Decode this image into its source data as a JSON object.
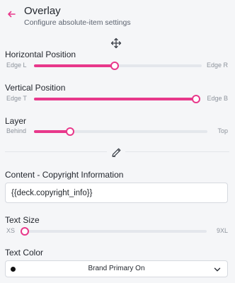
{
  "header": {
    "title": "Overlay",
    "subtitle": "Configure absolute-item settings",
    "back_icon": "arrow-left-icon"
  },
  "accent_color": "#e8388b",
  "sliders": [
    {
      "label": "Horizontal Position",
      "min_label": "Edge L",
      "max_label": "Edge R",
      "value_fraction": 0.48
    },
    {
      "label": "Vertical Position",
      "min_label": "Edge T",
      "max_label": "Edge B",
      "value_fraction": 1.0
    },
    {
      "label": "Layer",
      "min_label": "Behind",
      "max_label": "Top",
      "value_fraction": 0.21
    }
  ],
  "section_icons": {
    "move": "move-arrows-icon",
    "edit": "pencil-icon"
  },
  "content": {
    "label": "Content - Copyright Information",
    "value": "{{deck.copyright_info}}"
  },
  "text_size": {
    "label": "Text Size",
    "min_label": "XS",
    "max_label": "9XL",
    "value_fraction": 0.0
  },
  "text_color": {
    "label": "Text Color",
    "selected": "Brand Primary On",
    "swatch_color": "#111111"
  }
}
